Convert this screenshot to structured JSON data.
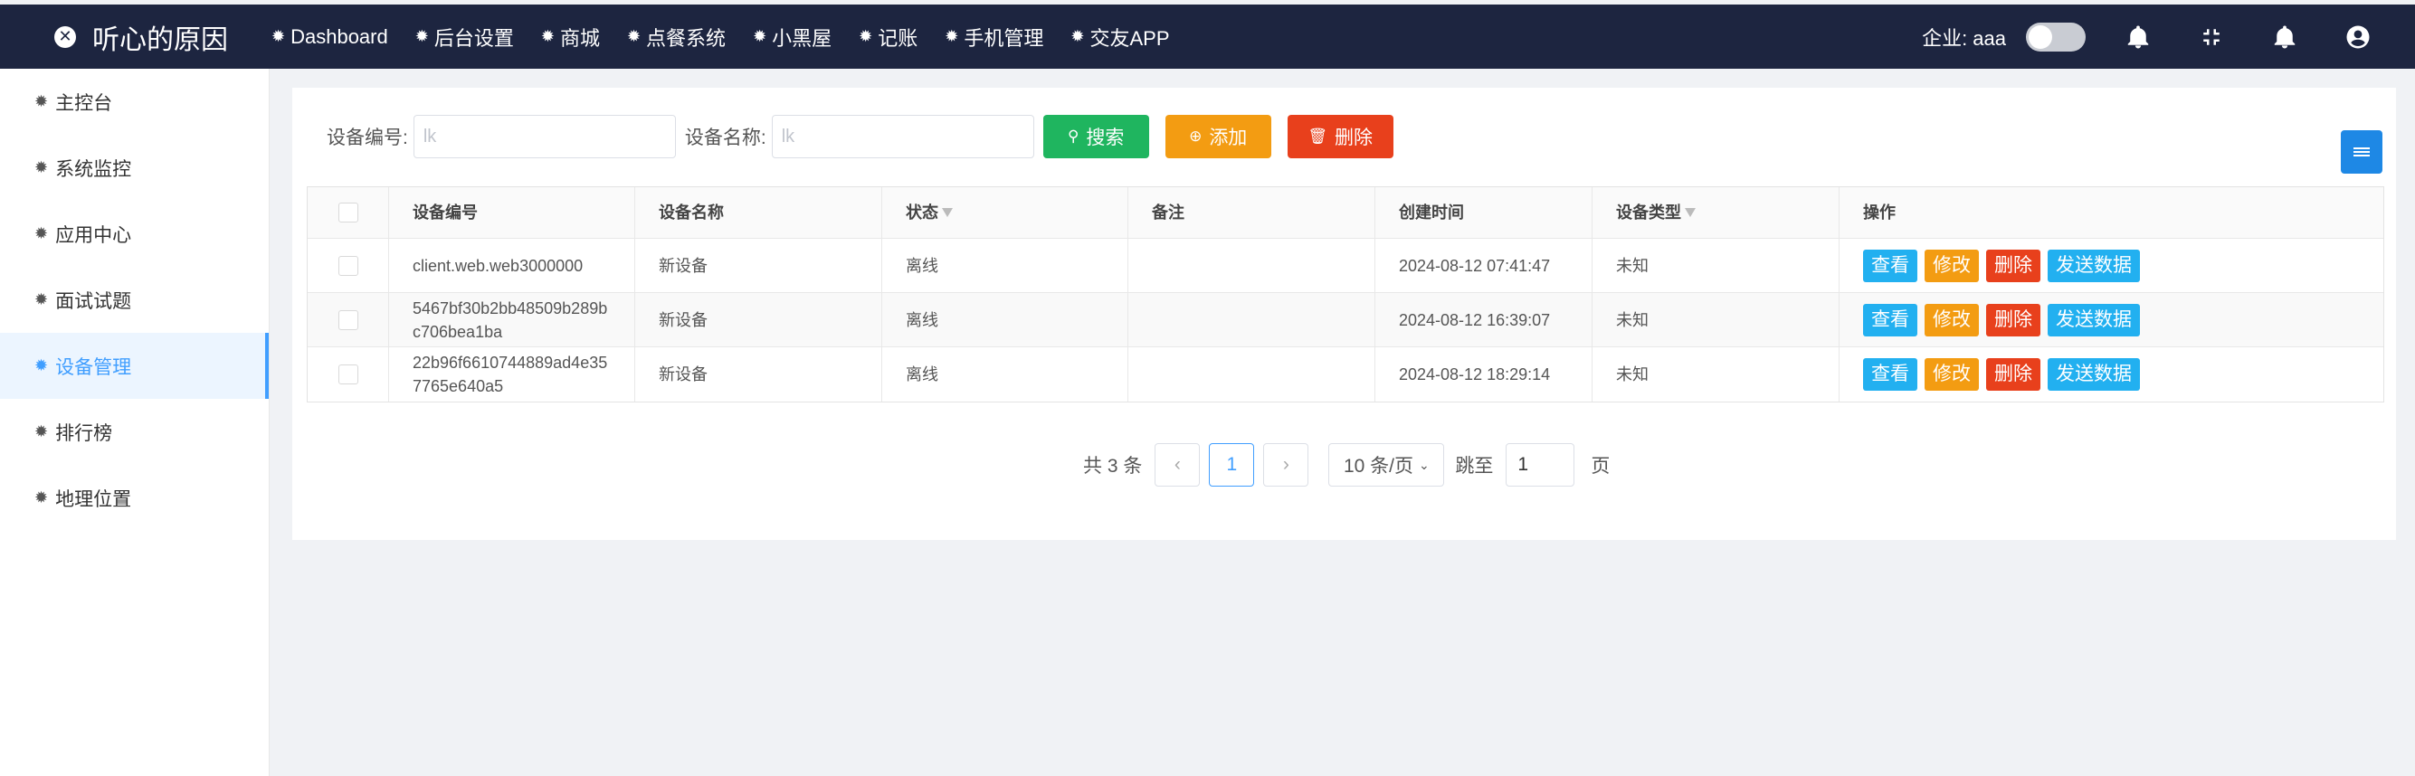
{
  "app": {
    "title": "听心的原因"
  },
  "topnav": [
    {
      "label": "Dashboard"
    },
    {
      "label": "后台设置"
    },
    {
      "label": "商城"
    },
    {
      "label": "点餐系统"
    },
    {
      "label": "小黑屋"
    },
    {
      "label": "记账"
    },
    {
      "label": "手机管理"
    },
    {
      "label": "交友APP"
    }
  ],
  "header": {
    "company": "企业: aaa"
  },
  "sidebar": {
    "items": [
      {
        "label": "主控台"
      },
      {
        "label": "系统监控"
      },
      {
        "label": "应用中心"
      },
      {
        "label": "面试试题"
      },
      {
        "label": "设备管理"
      },
      {
        "label": "排行榜"
      },
      {
        "label": "地理位置"
      }
    ],
    "active_index": 4
  },
  "search": {
    "code_label": "设备编号:",
    "code_placeholder": "lk",
    "name_label": "设备名称:",
    "name_placeholder": "lk",
    "search_label": "搜索",
    "add_label": "添加",
    "delete_label": "删除"
  },
  "table": {
    "headers": [
      "设备编号",
      "设备名称",
      "状态",
      "备注",
      "创建时间",
      "设备类型",
      "操作"
    ],
    "rows": [
      {
        "code_line1": "client.web.web3000000",
        "code_line2": "",
        "name": "新设备",
        "status": "离线",
        "note": "",
        "created": "2024-08-12 07:41:47",
        "type": "未知"
      },
      {
        "code_line1": "5467bf30b2bb48509b289b",
        "code_line2": "c706bea1ba",
        "name": "新设备",
        "status": "离线",
        "note": "",
        "created": "2024-08-12 16:39:07",
        "type": "未知"
      },
      {
        "code_line1": "22b96f6610744889ad4e35",
        "code_line2": "7765e640a5",
        "name": "新设备",
        "status": "离线",
        "note": "",
        "created": "2024-08-12 18:29:14",
        "type": "未知"
      }
    ],
    "actions": {
      "view": "查看",
      "edit": "修改",
      "delete": "删除",
      "send": "发送数据"
    }
  },
  "pagination": {
    "total": "共 3 条",
    "prev": "‹",
    "current": "1",
    "next": "›",
    "page_size": "10 条/页",
    "jump_label": "跳至",
    "jump_value": "1",
    "page_suffix": "页"
  }
}
